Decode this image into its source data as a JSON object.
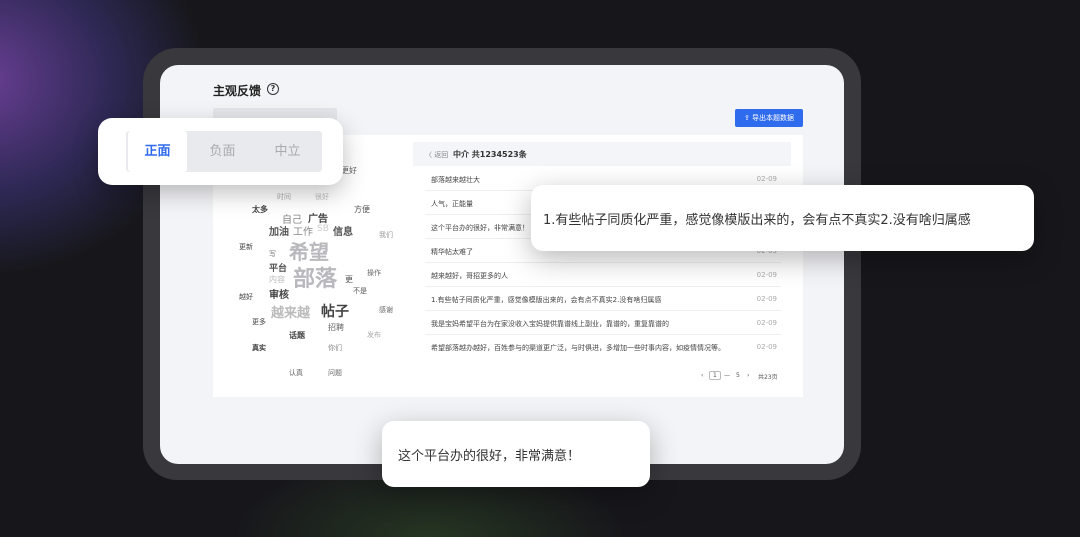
{
  "panel": {
    "title": "主观反馈",
    "help_icon": "?",
    "export_label": "⇪ 导出本题数据"
  },
  "sentiment_tabs": [
    {
      "label": "正面",
      "active": true
    },
    {
      "label": "负面",
      "active": false
    },
    {
      "label": "中立",
      "active": false
    }
  ],
  "word_cloud": [
    {
      "word": "更好"
    },
    {
      "word": "时间"
    },
    {
      "word": "很好"
    },
    {
      "word": "太多"
    },
    {
      "word": "方便"
    },
    {
      "word": "自己"
    },
    {
      "word": "广告"
    },
    {
      "word": "加油"
    },
    {
      "word": "工作"
    },
    {
      "word": "SB"
    },
    {
      "word": "信息"
    },
    {
      "word": "我们"
    },
    {
      "word": "更新"
    },
    {
      "word": "希望"
    },
    {
      "word": "写"
    },
    {
      "word": "平台"
    },
    {
      "word": "部落"
    },
    {
      "word": "内容"
    },
    {
      "word": "操作"
    },
    {
      "word": "更"
    },
    {
      "word": "审核"
    },
    {
      "word": "越好"
    },
    {
      "word": "不是"
    },
    {
      "word": "越来越"
    },
    {
      "word": "帖子"
    },
    {
      "word": "感谢"
    },
    {
      "word": "更多"
    },
    {
      "word": "招聘"
    },
    {
      "word": "话题"
    },
    {
      "word": "发布"
    },
    {
      "word": "真实"
    },
    {
      "word": "你们"
    },
    {
      "word": "认真"
    },
    {
      "word": "问题"
    }
  ],
  "list": {
    "back_label": "〈 返回",
    "title": "中介 共1234523条",
    "rows": [
      {
        "text": "部落越来越壮大",
        "date": "02-09"
      },
      {
        "text": "人气，正能量",
        "date": "02-09"
      },
      {
        "text": "这个平台办的很好，非常满意！",
        "date": "02-09"
      },
      {
        "text": "精华帖太难了",
        "date": "02-09"
      },
      {
        "text": "越来越好，哥招更多的人",
        "date": "02-09"
      },
      {
        "text": "1.有些帖子同质化严重，感觉像模版出来的，会有点不真实2.没有啥归属感",
        "date": "02-09"
      },
      {
        "text": "我是宝妈希望平台为在家没收入宝妈提供靠谱线上副业，靠谱的，重复靠谱的",
        "date": "02-09"
      },
      {
        "text": "希望部落越办越好，百姓参与的渠道更广泛，与时俱进，多增加一些时事内容，如疫情情况等。",
        "date": "02-09"
      }
    ],
    "pager": {
      "prev": "‹",
      "current": "1",
      "ellipsis": "—",
      "last": "5",
      "next": "›",
      "total": "共23页"
    }
  },
  "callouts": {
    "top_right": "1.有些帖子同质化严重，感觉像模版出来的，会有点不真实2.没有啥归属感",
    "bottom": "这个平台办的很好，非常满意！"
  }
}
